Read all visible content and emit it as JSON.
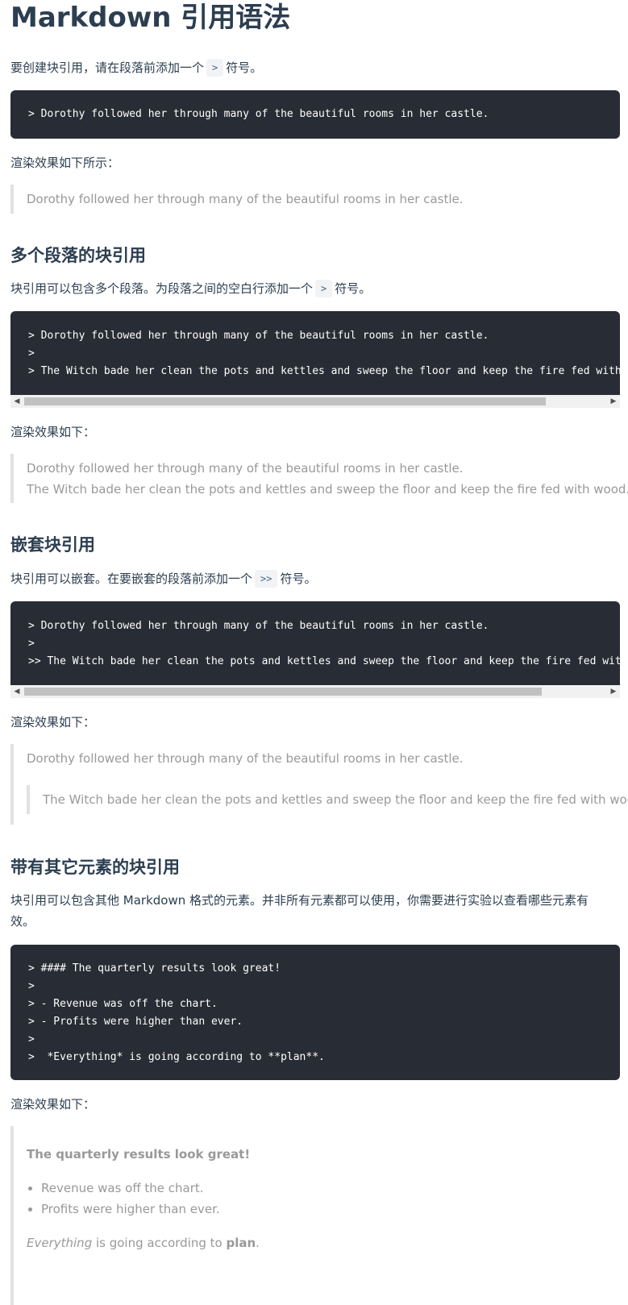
{
  "title": "Markdown 引用语法",
  "s1": {
    "p_before": "要创建块引用，请在段落前添加一个",
    "p_code": ">",
    "p_after": "符号。",
    "code": "> Dorothy followed her through many of the beautiful rooms in her castle.",
    "render_label": "渲染效果如下所示：",
    "quote": "Dorothy followed her through many of the beautiful rooms in her castle."
  },
  "s2": {
    "heading": "多个段落的块引用",
    "p_before": "块引用可以包含多个段落。为段落之间的空白行添加一个",
    "p_code": ">",
    "p_after": "符号。",
    "code": "> Dorothy followed her through many of the beautiful rooms in her castle.\n>\n> The Witch bade her clean the pots and kettles and sweep the floor and keep the fire fed with wood.",
    "render_label": "渲染效果如下：",
    "quote1": "Dorothy followed her through many of the beautiful rooms in her castle.",
    "quote2": "The Witch bade her clean the pots and kettles and sweep the floor and keep the fire fed with wood."
  },
  "s3": {
    "heading": "嵌套块引用",
    "p_before": "块引用可以嵌套。在要嵌套的段落前添加一个",
    "p_code": ">>",
    "p_after": "符号。",
    "code": "> Dorothy followed her through many of the beautiful rooms in her castle.\n>\n>> The Witch bade her clean the pots and kettles and sweep the floor and keep the fire fed with wood.",
    "render_label": "渲染效果如下：",
    "quote1": "Dorothy followed her through many of the beautiful rooms in her castle.",
    "quote2": "The Witch bade her clean the pots and kettles and sweep the floor and keep the fire fed with wood."
  },
  "s4": {
    "heading": "带有其它元素的块引用",
    "p": "块引用可以包含其他 Markdown 格式的元素。并非所有元素都可以使用，你需要进行实验以查看哪些元素有效。",
    "code": "> #### The quarterly results look great!\n>\n> - Revenue was off the chart.\n> - Profits were higher than ever.\n>\n>  *Everything* is going according to **plan**.",
    "render_label": "渲染效果如下：",
    "quote_heading": "The quarterly results look great!",
    "li1": "Revenue was off the chart.",
    "li2": "Profits were higher than ever.",
    "em": "Everything",
    "mid": " is going according to ",
    "strong": "plan",
    "end": "."
  },
  "scroll_left_icon": "triangle-left",
  "scroll_right_icon": "triangle-right"
}
